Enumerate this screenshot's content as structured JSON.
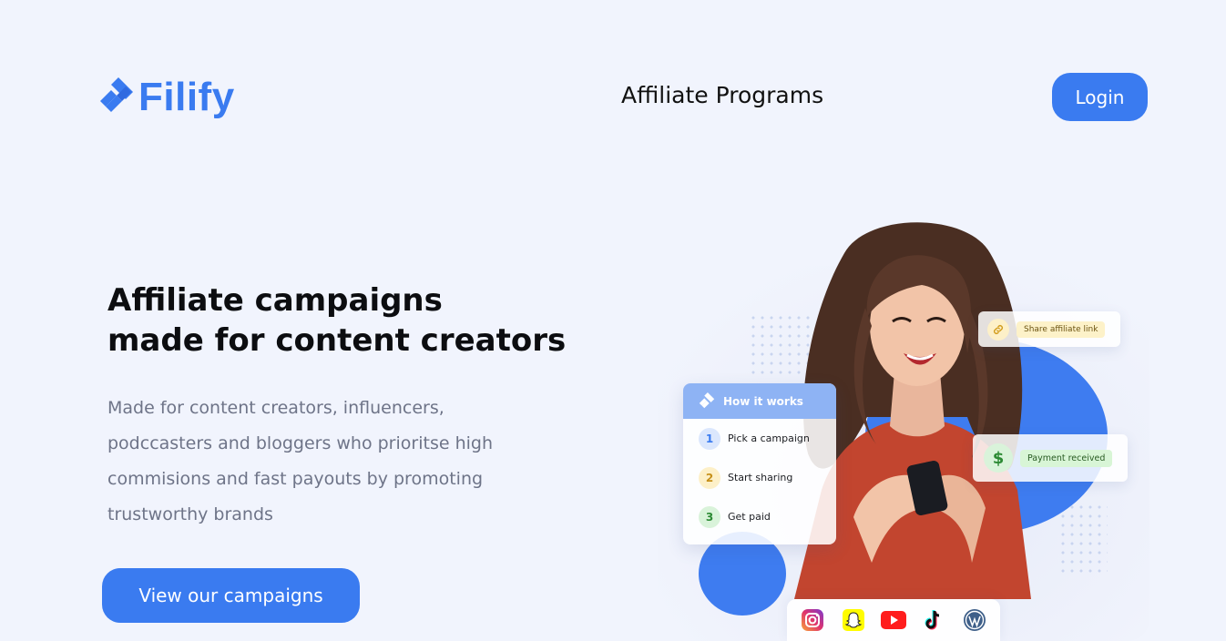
{
  "header": {
    "brand": "Filify",
    "nav_link": "Affiliate Programs",
    "login_label": "Login"
  },
  "hero": {
    "title_line1": "Affiliate campaigns",
    "title_line2": "made for content creators",
    "description": "Made for content creators, influencers, podccasters and bloggers who prioritse high commisions and fast payouts by promoting trustworthy brands",
    "cta_label": "View our campaigns"
  },
  "illustration": {
    "how_title": "How it works",
    "steps": [
      {
        "num": "1",
        "label": "Pick a campaign"
      },
      {
        "num": "2",
        "label": "Start sharing"
      },
      {
        "num": "3",
        "label": "Get paid"
      }
    ],
    "share_tag": "Share affiliate link",
    "payment_tag": "Payment received",
    "dollar_symbol": "$",
    "socials": [
      "instagram-icon",
      "snapchat-icon",
      "youtube-icon",
      "tiktok-icon",
      "wordpress-icon"
    ]
  },
  "colors": {
    "accent": "#3a7bf0",
    "background": "#f1f4fd"
  }
}
